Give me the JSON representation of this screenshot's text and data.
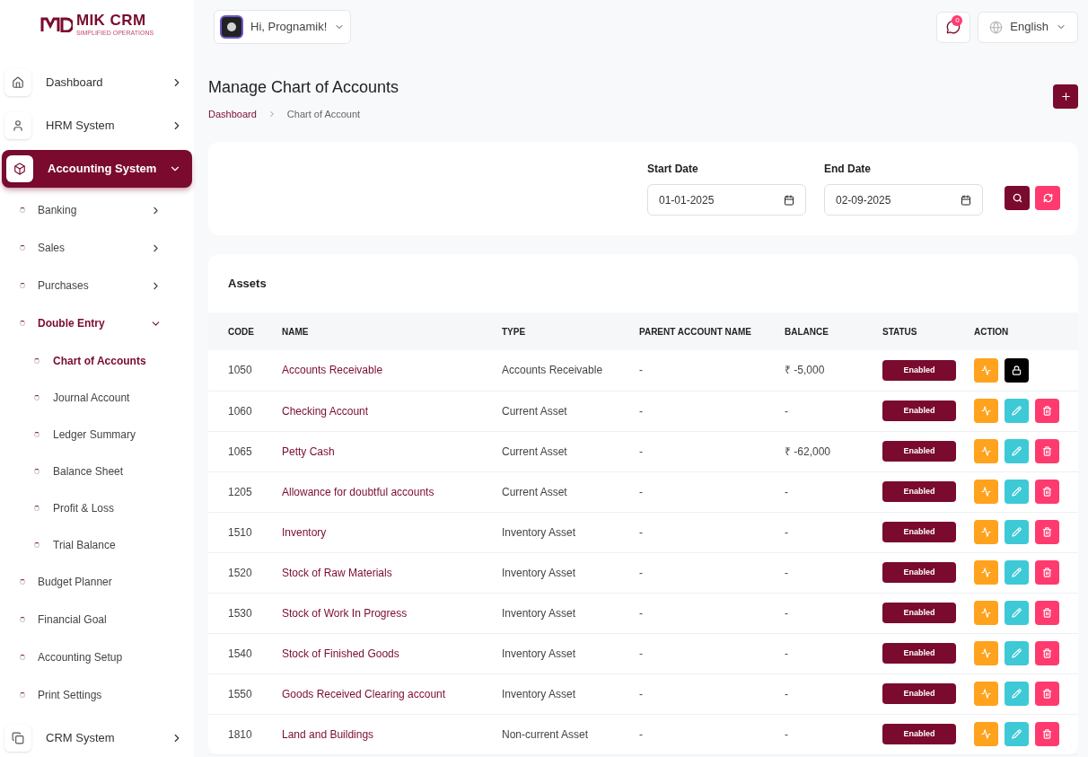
{
  "logo": {
    "name": "MIK CRM",
    "tagline": "SIMPLIFIED OPERATIONS"
  },
  "user_menu": {
    "greeting": "Hi, Prognamik!"
  },
  "notifications": {
    "count": "0"
  },
  "language": {
    "label": "English"
  },
  "sidebar": {
    "items": [
      {
        "label": "Dashboard",
        "kind": "module",
        "selected": false,
        "expanded": false
      },
      {
        "label": "HRM System",
        "kind": "module",
        "selected": false,
        "expanded": false
      },
      {
        "label": "Accounting System",
        "kind": "module",
        "selected": true,
        "expanded": true,
        "children": [
          {
            "label": "Banking",
            "kind": "group",
            "selected": false,
            "expanded": false
          },
          {
            "label": "Sales",
            "kind": "group",
            "selected": false,
            "expanded": false
          },
          {
            "label": "Purchases",
            "kind": "group",
            "selected": false,
            "expanded": false
          },
          {
            "label": "Double Entry",
            "kind": "group",
            "selected": true,
            "expanded": true,
            "children": [
              {
                "label": "Chart of Accounts",
                "selected": true
              },
              {
                "label": "Journal Account",
                "selected": false
              },
              {
                "label": "Ledger Summary",
                "selected": false
              },
              {
                "label": "Balance Sheet",
                "selected": false
              },
              {
                "label": "Profit & Loss",
                "selected": false
              },
              {
                "label": "Trial Balance",
                "selected": false
              }
            ]
          },
          {
            "label": "Budget Planner",
            "kind": "link",
            "selected": false
          },
          {
            "label": "Financial Goal",
            "kind": "link",
            "selected": false
          },
          {
            "label": "Accounting Setup",
            "kind": "link",
            "selected": false
          },
          {
            "label": "Print Settings",
            "kind": "link",
            "selected": false
          }
        ]
      },
      {
        "label": "CRM System",
        "kind": "module",
        "selected": false,
        "expanded": false
      }
    ]
  },
  "page": {
    "title": "Manage Chart of Accounts",
    "breadcrumb": [
      "Dashboard",
      "Chart of Account"
    ]
  },
  "filters": [
    {
      "label": "Start Date",
      "value": "01-01-2025"
    },
    {
      "label": "End Date",
      "value": "02-09-2025"
    }
  ],
  "table": {
    "title": "Assets",
    "columns": [
      "CODE",
      "NAME",
      "TYPE",
      "PARENT ACCOUNT NAME",
      "BALANCE",
      "STATUS",
      "ACTION"
    ],
    "rows": [
      {
        "code": "1050",
        "name": "Accounts Receivable",
        "type": "Accounts Receivable",
        "parent": "-",
        "balance": "₹ -5,000",
        "status": "Enabled",
        "actions": [
          {
            "kind": "transactions"
          },
          {
            "kind": "lock"
          }
        ]
      },
      {
        "code": "1060",
        "name": "Checking Account",
        "type": "Current Asset",
        "parent": "-",
        "balance": "-",
        "status": "Enabled",
        "actions": [
          {
            "kind": "transactions"
          },
          {
            "kind": "edit"
          },
          {
            "kind": "delete"
          }
        ]
      },
      {
        "code": "1065",
        "name": "Petty Cash",
        "type": "Current Asset",
        "parent": "-",
        "balance": "₹ -62,000",
        "status": "Enabled",
        "actions": [
          {
            "kind": "transactions"
          },
          {
            "kind": "edit"
          },
          {
            "kind": "delete"
          }
        ]
      },
      {
        "code": "1205",
        "name": "Allowance for doubtful accounts",
        "type": "Current Asset",
        "parent": "-",
        "balance": "-",
        "status": "Enabled",
        "actions": [
          {
            "kind": "transactions"
          },
          {
            "kind": "edit"
          },
          {
            "kind": "delete"
          }
        ]
      },
      {
        "code": "1510",
        "name": "Inventory",
        "type": "Inventory Asset",
        "parent": "-",
        "balance": "-",
        "status": "Enabled",
        "actions": [
          {
            "kind": "transactions"
          },
          {
            "kind": "edit"
          },
          {
            "kind": "delete"
          }
        ]
      },
      {
        "code": "1520",
        "name": "Stock of Raw Materials",
        "type": "Inventory Asset",
        "parent": "-",
        "balance": "-",
        "status": "Enabled",
        "actions": [
          {
            "kind": "transactions"
          },
          {
            "kind": "edit"
          },
          {
            "kind": "delete"
          }
        ]
      },
      {
        "code": "1530",
        "name": "Stock of Work In Progress",
        "type": "Inventory Asset",
        "parent": "-",
        "balance": "-",
        "status": "Enabled",
        "actions": [
          {
            "kind": "transactions"
          },
          {
            "kind": "edit"
          },
          {
            "kind": "delete"
          }
        ]
      },
      {
        "code": "1540",
        "name": "Stock of Finished Goods",
        "type": "Inventory Asset",
        "parent": "-",
        "balance": "-",
        "status": "Enabled",
        "actions": [
          {
            "kind": "transactions"
          },
          {
            "kind": "edit"
          },
          {
            "kind": "delete"
          }
        ]
      },
      {
        "code": "1550",
        "name": "Goods Received Clearing account",
        "type": "Inventory Asset",
        "parent": "-",
        "balance": "-",
        "status": "Enabled",
        "actions": [
          {
            "kind": "transactions"
          },
          {
            "kind": "edit"
          },
          {
            "kind": "delete"
          }
        ]
      },
      {
        "code": "1810",
        "name": "Land and Buildings",
        "type": "Non-current Asset",
        "parent": "-",
        "balance": "-",
        "status": "Enabled",
        "actions": [
          {
            "kind": "transactions"
          },
          {
            "kind": "edit"
          },
          {
            "kind": "delete"
          }
        ]
      }
    ]
  }
}
